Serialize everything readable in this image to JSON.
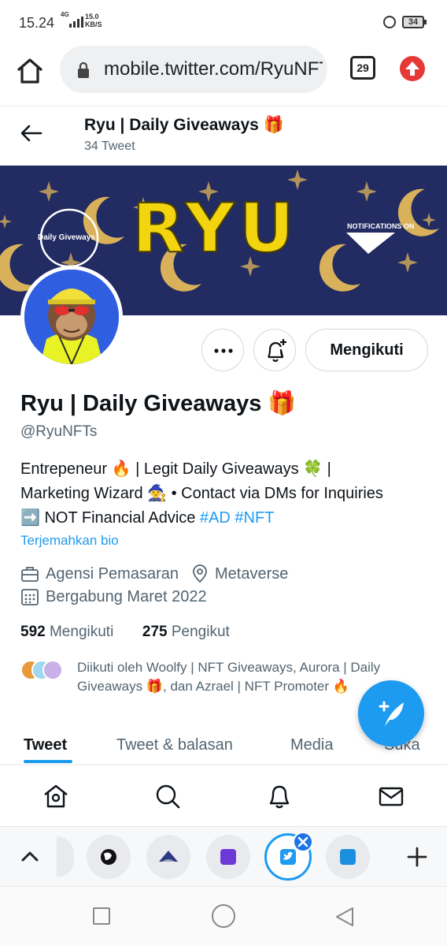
{
  "status_bar": {
    "time": "15.24",
    "network": "4G",
    "speed_value": "15.0",
    "speed_unit": "KB/S",
    "battery": "34"
  },
  "browser": {
    "url": "mobile.twitter.com/RyuNFTs",
    "tab_count": "29"
  },
  "header": {
    "name": "Ryu | Daily Giveaways 🎁",
    "tweet_count": "34 Tweet"
  },
  "banner": {
    "title": "RYU",
    "left_label": "Daily Giveways",
    "right_label": "NOTIFICATIONS ON"
  },
  "profile": {
    "follow_button": "Mengikuti",
    "name": "Ryu | Daily Giveaways 🎁",
    "handle": "@RyuNFTs",
    "bio_line1": "Entrepeneur 🔥 | Legit Daily Giveaways  🍀 |",
    "bio_line2": "Marketing Wizard 🧙 • Contact via DMs for Inquiries",
    "bio_line3": "➡️ NOT Financial Advice ",
    "hashtag1": "#AD",
    "hashtag2": "#NFT",
    "translate_link": "Terjemahkan bio",
    "category": "Agensi Pemasaran",
    "location": "Metaverse",
    "joined": "Bergabung Maret 2022",
    "following_count": "592",
    "following_label": "Mengikuti",
    "followers_count": "275",
    "followers_label": "Pengikut",
    "followed_by": "Diikuti oleh Woolfy | NFT Giveaways, Aurora | Daily Giveaways 🎁, dan Azrael | NFT Promoter 🔥"
  },
  "tabs": [
    {
      "label": "Tweet"
    },
    {
      "label": "Tweet & balasan"
    },
    {
      "label": "Media"
    },
    {
      "label": "Suka"
    }
  ],
  "icons": {
    "bottom_nav": [
      "home-icon",
      "search-icon",
      "notifications-icon",
      "messages-icon"
    ],
    "browser_tabs": [
      "chevron-up-icon",
      "globe-icon",
      "ape-icon",
      "list-icon",
      "twitter-icon",
      "amazon-icon",
      "plus-icon"
    ]
  },
  "colors": {
    "accent": "#1d9bf0",
    "banner_bg": "#222b62",
    "banner_title": "#f2d50f",
    "secondary_text": "#536471"
  }
}
